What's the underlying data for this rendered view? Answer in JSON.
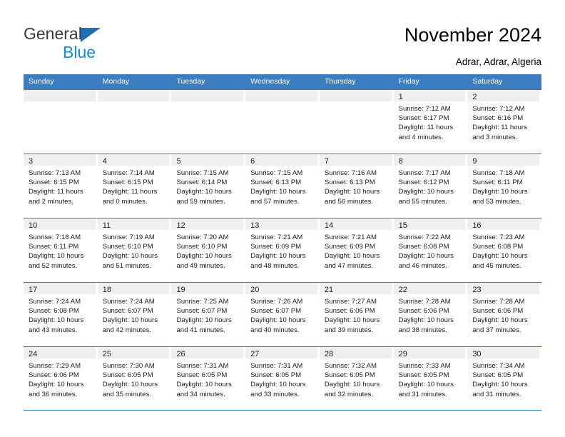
{
  "brand": {
    "name_part1": "General",
    "name_part2": "Blue",
    "triangle_color": "#1c6fb5",
    "blue_color": "#1b87d8"
  },
  "header": {
    "title": "November 2024",
    "location": "Adrar, Adrar, Algeria"
  },
  "theme": {
    "header_blue": "#3a7dc0",
    "daynum_bg": "#efefef",
    "text": "#1c1c1c"
  },
  "weekdays": [
    "Sunday",
    "Monday",
    "Tuesday",
    "Wednesday",
    "Thursday",
    "Friday",
    "Saturday"
  ],
  "weeks": [
    [
      {
        "day": "",
        "sunrise": "",
        "sunset": "",
        "daylight": ""
      },
      {
        "day": "",
        "sunrise": "",
        "sunset": "",
        "daylight": ""
      },
      {
        "day": "",
        "sunrise": "",
        "sunset": "",
        "daylight": ""
      },
      {
        "day": "",
        "sunrise": "",
        "sunset": "",
        "daylight": ""
      },
      {
        "day": "",
        "sunrise": "",
        "sunset": "",
        "daylight": ""
      },
      {
        "day": "1",
        "sunrise": "Sunrise: 7:12 AM",
        "sunset": "Sunset: 6:17 PM",
        "daylight": "Daylight: 11 hours and 4 minutes."
      },
      {
        "day": "2",
        "sunrise": "Sunrise: 7:12 AM",
        "sunset": "Sunset: 6:16 PM",
        "daylight": "Daylight: 11 hours and 3 minutes."
      }
    ],
    [
      {
        "day": "3",
        "sunrise": "Sunrise: 7:13 AM",
        "sunset": "Sunset: 6:15 PM",
        "daylight": "Daylight: 11 hours and 2 minutes."
      },
      {
        "day": "4",
        "sunrise": "Sunrise: 7:14 AM",
        "sunset": "Sunset: 6:15 PM",
        "daylight": "Daylight: 11 hours and 0 minutes."
      },
      {
        "day": "5",
        "sunrise": "Sunrise: 7:15 AM",
        "sunset": "Sunset: 6:14 PM",
        "daylight": "Daylight: 10 hours and 59 minutes."
      },
      {
        "day": "6",
        "sunrise": "Sunrise: 7:15 AM",
        "sunset": "Sunset: 6:13 PM",
        "daylight": "Daylight: 10 hours and 57 minutes."
      },
      {
        "day": "7",
        "sunrise": "Sunrise: 7:16 AM",
        "sunset": "Sunset: 6:13 PM",
        "daylight": "Daylight: 10 hours and 56 minutes."
      },
      {
        "day": "8",
        "sunrise": "Sunrise: 7:17 AM",
        "sunset": "Sunset: 6:12 PM",
        "daylight": "Daylight: 10 hours and 55 minutes."
      },
      {
        "day": "9",
        "sunrise": "Sunrise: 7:18 AM",
        "sunset": "Sunset: 6:11 PM",
        "daylight": "Daylight: 10 hours and 53 minutes."
      }
    ],
    [
      {
        "day": "10",
        "sunrise": "Sunrise: 7:18 AM",
        "sunset": "Sunset: 6:11 PM",
        "daylight": "Daylight: 10 hours and 52 minutes."
      },
      {
        "day": "11",
        "sunrise": "Sunrise: 7:19 AM",
        "sunset": "Sunset: 6:10 PM",
        "daylight": "Daylight: 10 hours and 51 minutes."
      },
      {
        "day": "12",
        "sunrise": "Sunrise: 7:20 AM",
        "sunset": "Sunset: 6:10 PM",
        "daylight": "Daylight: 10 hours and 49 minutes."
      },
      {
        "day": "13",
        "sunrise": "Sunrise: 7:21 AM",
        "sunset": "Sunset: 6:09 PM",
        "daylight": "Daylight: 10 hours and 48 minutes."
      },
      {
        "day": "14",
        "sunrise": "Sunrise: 7:21 AM",
        "sunset": "Sunset: 6:09 PM",
        "daylight": "Daylight: 10 hours and 47 minutes."
      },
      {
        "day": "15",
        "sunrise": "Sunrise: 7:22 AM",
        "sunset": "Sunset: 6:08 PM",
        "daylight": "Daylight: 10 hours and 46 minutes."
      },
      {
        "day": "16",
        "sunrise": "Sunrise: 7:23 AM",
        "sunset": "Sunset: 6:08 PM",
        "daylight": "Daylight: 10 hours and 45 minutes."
      }
    ],
    [
      {
        "day": "17",
        "sunrise": "Sunrise: 7:24 AM",
        "sunset": "Sunset: 6:08 PM",
        "daylight": "Daylight: 10 hours and 43 minutes."
      },
      {
        "day": "18",
        "sunrise": "Sunrise: 7:24 AM",
        "sunset": "Sunset: 6:07 PM",
        "daylight": "Daylight: 10 hours and 42 minutes."
      },
      {
        "day": "19",
        "sunrise": "Sunrise: 7:25 AM",
        "sunset": "Sunset: 6:07 PM",
        "daylight": "Daylight: 10 hours and 41 minutes."
      },
      {
        "day": "20",
        "sunrise": "Sunrise: 7:26 AM",
        "sunset": "Sunset: 6:07 PM",
        "daylight": "Daylight: 10 hours and 40 minutes."
      },
      {
        "day": "21",
        "sunrise": "Sunrise: 7:27 AM",
        "sunset": "Sunset: 6:06 PM",
        "daylight": "Daylight: 10 hours and 39 minutes."
      },
      {
        "day": "22",
        "sunrise": "Sunrise: 7:28 AM",
        "sunset": "Sunset: 6:06 PM",
        "daylight": "Daylight: 10 hours and 38 minutes."
      },
      {
        "day": "23",
        "sunrise": "Sunrise: 7:28 AM",
        "sunset": "Sunset: 6:06 PM",
        "daylight": "Daylight: 10 hours and 37 minutes."
      }
    ],
    [
      {
        "day": "24",
        "sunrise": "Sunrise: 7:29 AM",
        "sunset": "Sunset: 6:06 PM",
        "daylight": "Daylight: 10 hours and 36 minutes."
      },
      {
        "day": "25",
        "sunrise": "Sunrise: 7:30 AM",
        "sunset": "Sunset: 6:05 PM",
        "daylight": "Daylight: 10 hours and 35 minutes."
      },
      {
        "day": "26",
        "sunrise": "Sunrise: 7:31 AM",
        "sunset": "Sunset: 6:05 PM",
        "daylight": "Daylight: 10 hours and 34 minutes."
      },
      {
        "day": "27",
        "sunrise": "Sunrise: 7:31 AM",
        "sunset": "Sunset: 6:05 PM",
        "daylight": "Daylight: 10 hours and 33 minutes."
      },
      {
        "day": "28",
        "sunrise": "Sunrise: 7:32 AM",
        "sunset": "Sunset: 6:05 PM",
        "daylight": "Daylight: 10 hours and 32 minutes."
      },
      {
        "day": "29",
        "sunrise": "Sunrise: 7:33 AM",
        "sunset": "Sunset: 6:05 PM",
        "daylight": "Daylight: 10 hours and 31 minutes."
      },
      {
        "day": "30",
        "sunrise": "Sunrise: 7:34 AM",
        "sunset": "Sunset: 6:05 PM",
        "daylight": "Daylight: 10 hours and 31 minutes."
      }
    ]
  ]
}
